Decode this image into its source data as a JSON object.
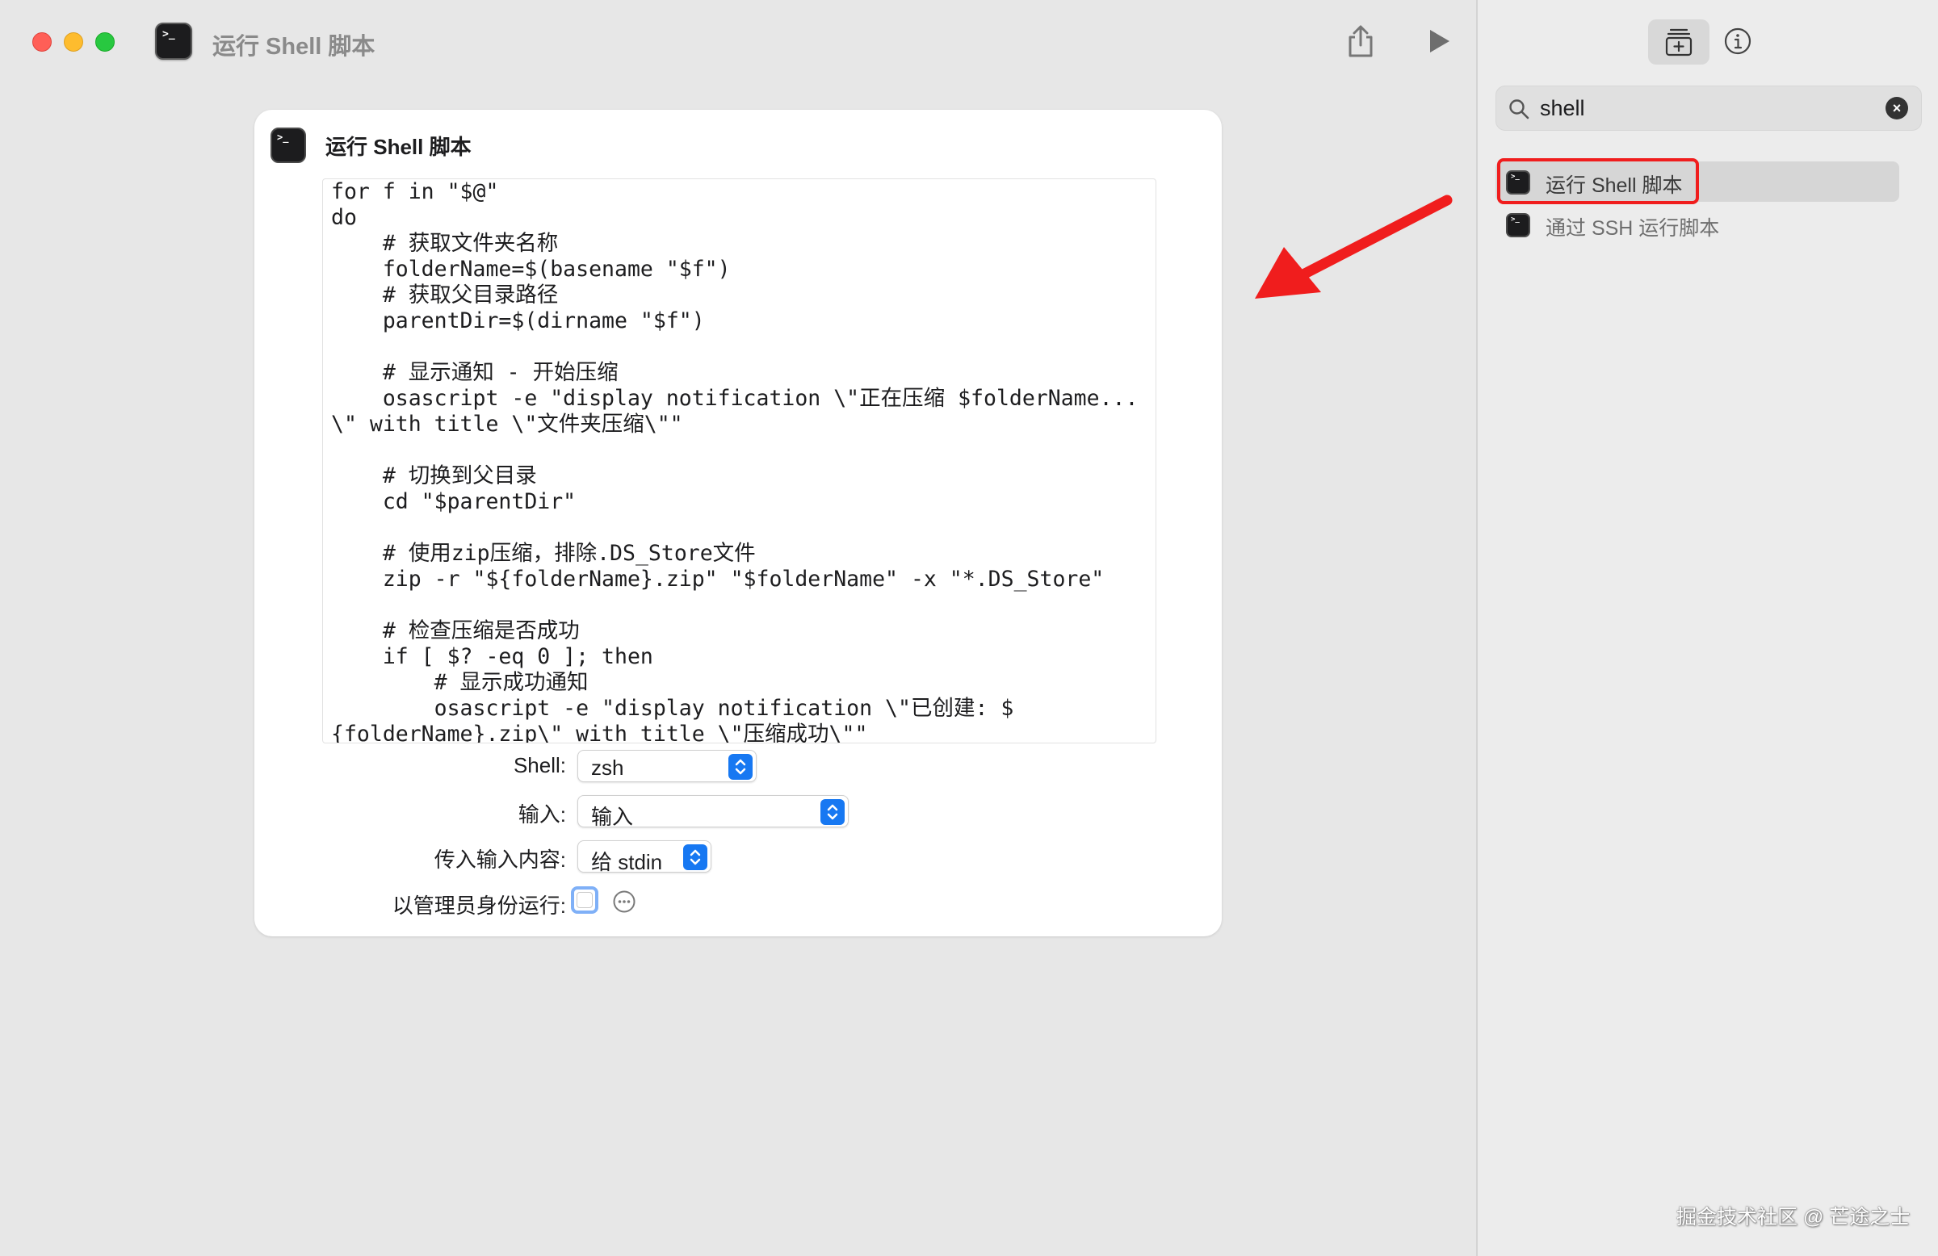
{
  "window": {
    "title": "运行 Shell 脚本",
    "icon_glyph": ">_"
  },
  "toolbar": {
    "share_icon": "share-icon",
    "run_icon": "play-icon"
  },
  "sidebar": {
    "tabs": [
      {
        "icon": "add-action-library-icon",
        "selected": true
      },
      {
        "icon": "info-icon",
        "selected": false
      }
    ],
    "search": {
      "value": "shell",
      "clear_glyph": "×"
    },
    "results": [
      {
        "label": "运行 Shell 脚本",
        "icon_glyph": ">_",
        "selected": true
      },
      {
        "label": "通过 SSH 运行脚本",
        "icon_glyph": ">_",
        "selected": false
      }
    ]
  },
  "action": {
    "title": "运行 Shell 脚本",
    "icon_glyph": ">_",
    "script": "for f in \"$@\"\ndo\n    # 获取文件夹名称\n    folderName=$(basename \"$f\")\n    # 获取父目录路径\n    parentDir=$(dirname \"$f\")\n\n    # 显示通知 - 开始压缩\n    osascript -e \"display notification \\\"正在压缩 $folderName...\n\\\" with title \\\"文件夹压缩\\\"\"\n\n    # 切换到父目录\n    cd \"$parentDir\"\n\n    # 使用zip压缩，排除.DS_Store文件\n    zip -r \"${folderName}.zip\" \"$folderName\" -x \"*.DS_Store\"\n\n    # 检查压缩是否成功\n    if [ $? -eq 0 ]; then\n        # 显示成功通知\n        osascript -e \"display notification \\\"已创建: $\n{folderName}.zip\\\" with title \\\"压缩成功\\\"\"",
    "params": {
      "shell": {
        "label": "Shell:",
        "value": "zsh"
      },
      "input": {
        "label": "输入:",
        "value": "输入"
      },
      "pass_input": {
        "label": "传入输入内容:",
        "value": "给 stdin"
      },
      "run_as_admin": {
        "label": "以管理员身份运行:",
        "checked": false
      }
    }
  },
  "watermark": "掘金技术社区 @ 芒途之士",
  "colors": {
    "accent": "#1778f2",
    "highlight": "#f01d1d",
    "close": "#ff5f57",
    "minimize": "#febc2e",
    "maximize": "#28c840"
  }
}
